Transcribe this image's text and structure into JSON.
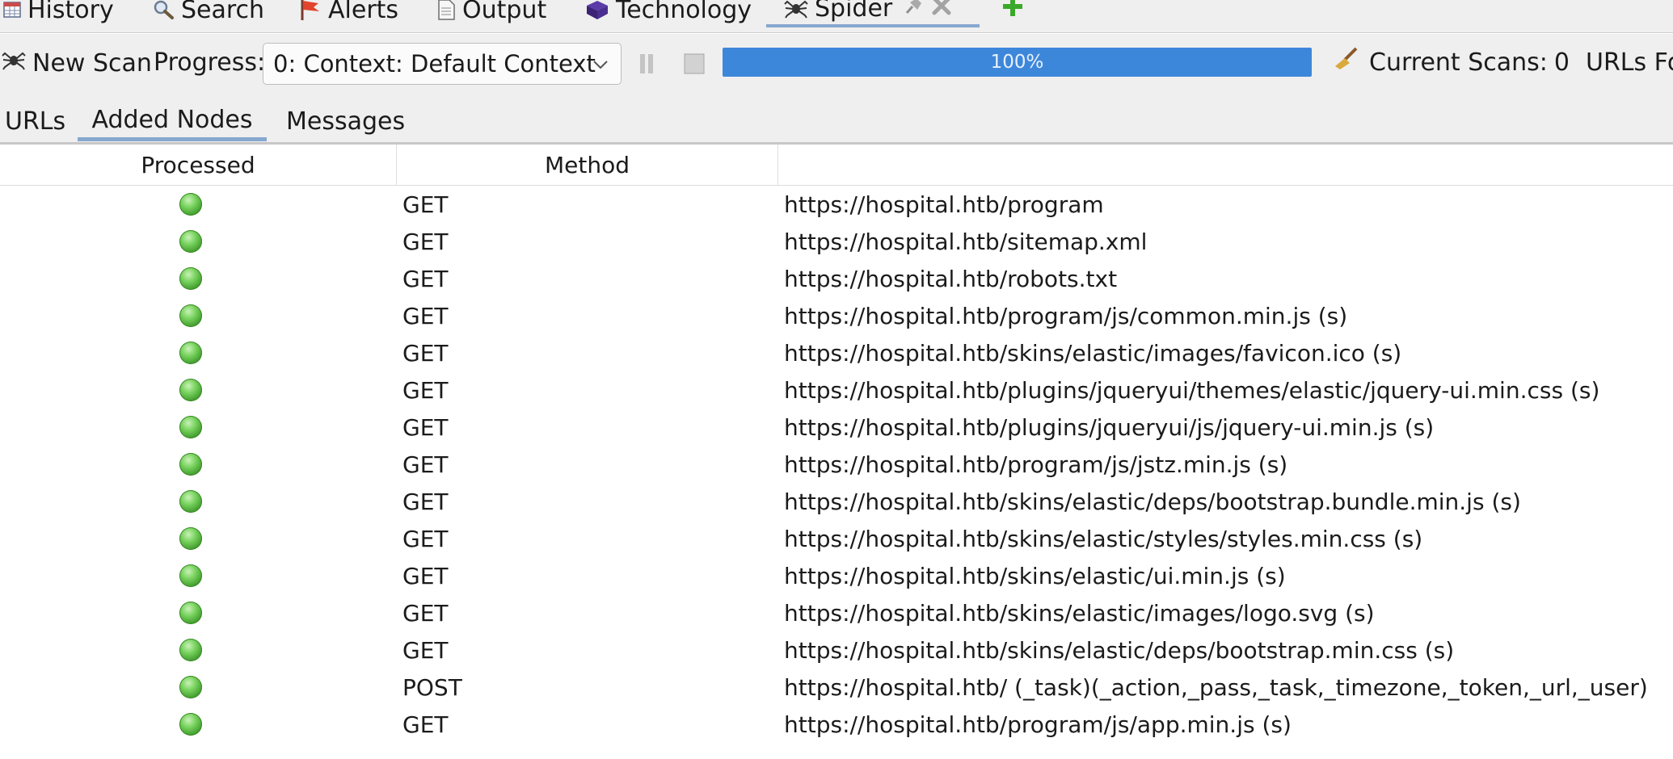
{
  "tabs": [
    {
      "label": "History",
      "icon": "table-icon"
    },
    {
      "label": "Search",
      "icon": "magnifier-icon"
    },
    {
      "label": "Alerts",
      "icon": "flag-icon"
    },
    {
      "label": "Output",
      "icon": "document-icon"
    },
    {
      "label": "Technology",
      "icon": "cube-icon"
    },
    {
      "label": "Spider",
      "icon": "spider-icon",
      "active": true
    }
  ],
  "tab_actions": {
    "pin_icon": "pin-icon",
    "close_icon": "close-icon",
    "add_icon": "plus-icon"
  },
  "toolbar": {
    "new_scan_label": "New Scan",
    "progress_label": "Progress:",
    "context_value": "0: Context: Default Context",
    "progress_text": "100%",
    "progress_fraction": 1.0,
    "current_scans_label": "Current Scans:",
    "current_scans_value": "0",
    "urls_found_label": "URLs Foun"
  },
  "subtabs": [
    {
      "label": "URLs"
    },
    {
      "label": "Added Nodes",
      "active": true
    },
    {
      "label": "Messages"
    }
  ],
  "table": {
    "columns": [
      "Processed",
      "Method",
      ""
    ],
    "rows": [
      {
        "method": "GET",
        "uri": "https://hospital.htb/program"
      },
      {
        "method": "GET",
        "uri": "https://hospital.htb/sitemap.xml"
      },
      {
        "method": "GET",
        "uri": "https://hospital.htb/robots.txt"
      },
      {
        "method": "GET",
        "uri": "https://hospital.htb/program/js/common.min.js (s)"
      },
      {
        "method": "GET",
        "uri": "https://hospital.htb/skins/elastic/images/favicon.ico (s)"
      },
      {
        "method": "GET",
        "uri": "https://hospital.htb/plugins/jqueryui/themes/elastic/jquery-ui.min.css (s)"
      },
      {
        "method": "GET",
        "uri": "https://hospital.htb/plugins/jqueryui/js/jquery-ui.min.js (s)"
      },
      {
        "method": "GET",
        "uri": "https://hospital.htb/program/js/jstz.min.js (s)"
      },
      {
        "method": "GET",
        "uri": "https://hospital.htb/skins/elastic/deps/bootstrap.bundle.min.js (s)"
      },
      {
        "method": "GET",
        "uri": "https://hospital.htb/skins/elastic/styles/styles.min.css (s)"
      },
      {
        "method": "GET",
        "uri": "https://hospital.htb/skins/elastic/ui.min.js (s)"
      },
      {
        "method": "GET",
        "uri": "https://hospital.htb/skins/elastic/images/logo.svg (s)"
      },
      {
        "method": "GET",
        "uri": "https://hospital.htb/skins/elastic/deps/bootstrap.min.css (s)"
      },
      {
        "method": "POST",
        "uri": "https://hospital.htb/ (_task)(_action,_pass,_task,_timezone,_token,_url,_user)"
      },
      {
        "method": "GET",
        "uri": "https://hospital.htb/program/js/app.min.js (s)"
      }
    ]
  },
  "colors": {
    "processed_ok": "#4caf35",
    "progress_fill": "#3d87db",
    "active_tab_underline": "#86a8cf"
  }
}
